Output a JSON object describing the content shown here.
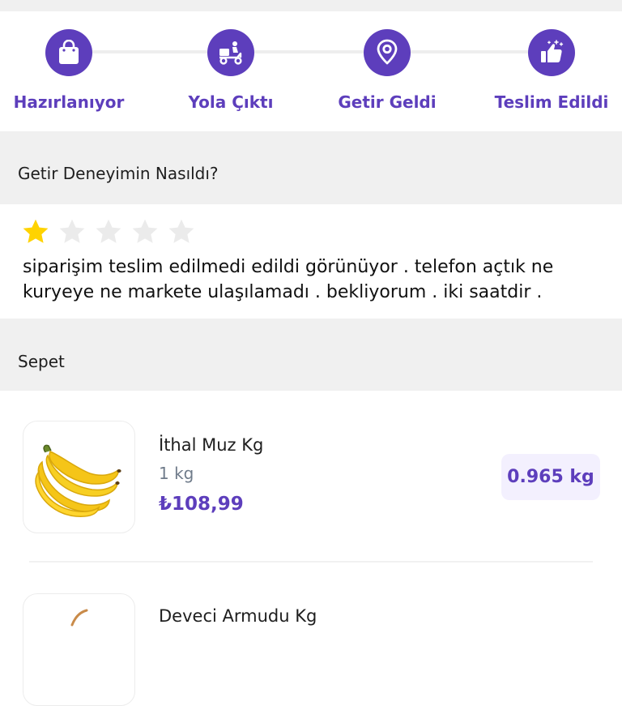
{
  "colors": {
    "brand": "#5d3ebc",
    "star_active": "#ffd300",
    "star_inactive": "#ebebeb",
    "badge_bg": "#f3f0fe"
  },
  "steps": [
    {
      "label": "Hazırlanıyor",
      "icon": "shopping-bag-icon"
    },
    {
      "label": "Yola Çıktı",
      "icon": "courier-scooter-icon"
    },
    {
      "label": "Getir Geldi",
      "icon": "location-pin-icon"
    },
    {
      "label": "Teslim Edildi",
      "icon": "thumbs-up-icon"
    }
  ],
  "experience": {
    "title": "Getir Deneyimin Nasıldı?",
    "rating": 1,
    "max_rating": 5,
    "comment": "siparişim teslim edilmedi edildi görünüyor . telefon açtık ne kuryeye ne markete ulaşılamadı . bekliyorum . iki saatdir ."
  },
  "basket": {
    "title": "Sepet",
    "items": [
      {
        "name": "İthal Muz Kg",
        "unit": "1 kg",
        "price": "₺108,99",
        "quantity": "0.965 kg",
        "icon": "banana-icon"
      },
      {
        "name": "Deveci Armudu Kg",
        "icon": "pear-icon"
      }
    ]
  }
}
